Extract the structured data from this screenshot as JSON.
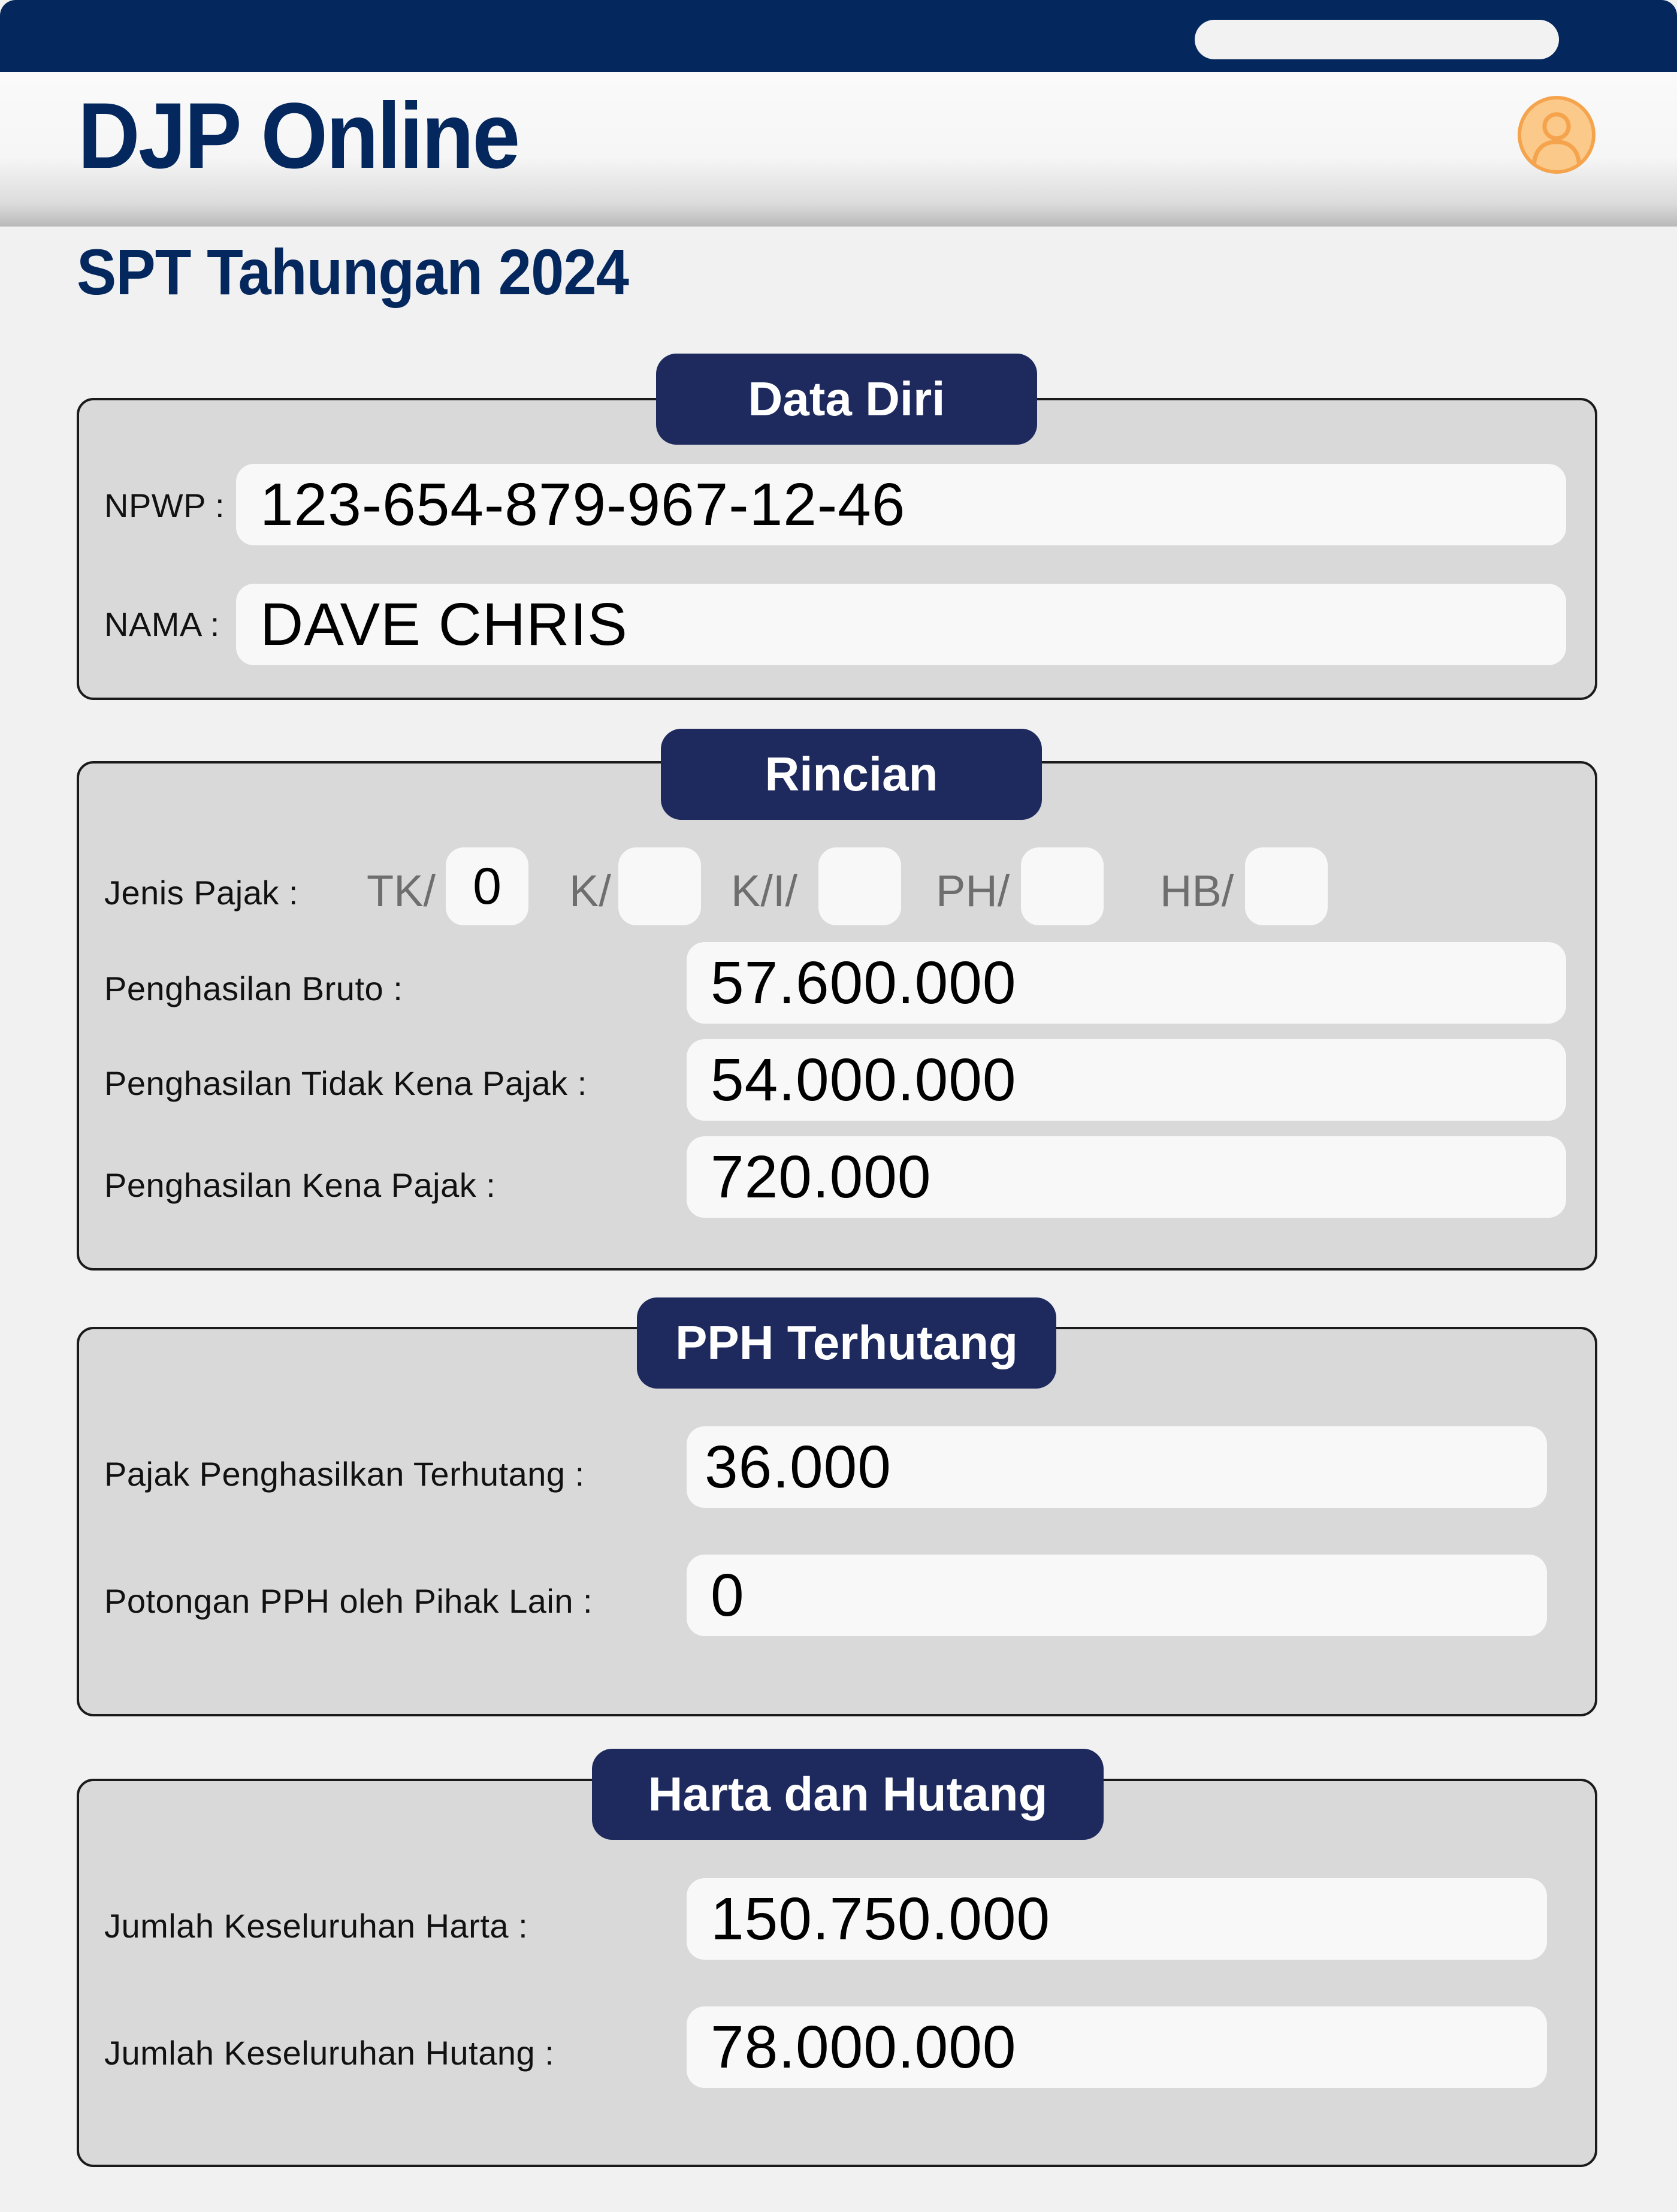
{
  "header": {
    "app_title": "DJP Online",
    "avatar_icon": "user-icon"
  },
  "page_title": "SPT Tahungan 2024",
  "data_diri": {
    "title": "Data Diri",
    "npwp_label": "NPWP :",
    "npwp_value": "123-654-879-967-12-46",
    "nama_label": "NAMA :",
    "nama_value": "DAVE CHRIS"
  },
  "rincian": {
    "title": "Rincian",
    "jenis_pajak_label": "Jenis Pajak :",
    "options": [
      {
        "label": "TK/",
        "value": "0"
      },
      {
        "label": "K/",
        "value": ""
      },
      {
        "label": "K/I/",
        "value": ""
      },
      {
        "label": "PH/",
        "value": ""
      },
      {
        "label": "HB/",
        "value": ""
      }
    ],
    "bruto_label": "Penghasilan Bruto :",
    "bruto_value": "57.600.000",
    "ptkp_label": "Penghasilan Tidak Kena Pajak :",
    "ptkp_value": "54.000.000",
    "pkp_label": "Penghasilan Kena Pajak :",
    "pkp_value": "720.000"
  },
  "pph": {
    "title": "PPH Terhutang",
    "terhutang_label": "Pajak Penghasilkan Terhutang :",
    "terhutang_value": "36.000",
    "potongan_label": "Potongan PPH oleh Pihak Lain :",
    "potongan_value": "0"
  },
  "harta": {
    "title": "Harta dan Hutang",
    "harta_label": "Jumlah Keseluruhan Harta :",
    "harta_value": "150.750.000",
    "hutang_label": "Jumlah Keseluruhan Hutang :",
    "hutang_value": "78.000.000"
  },
  "colors": {
    "navy": "#04285d",
    "tab": "#1e2a5e",
    "panel": "#d9d9d9",
    "avatar": "#fbca8a"
  }
}
